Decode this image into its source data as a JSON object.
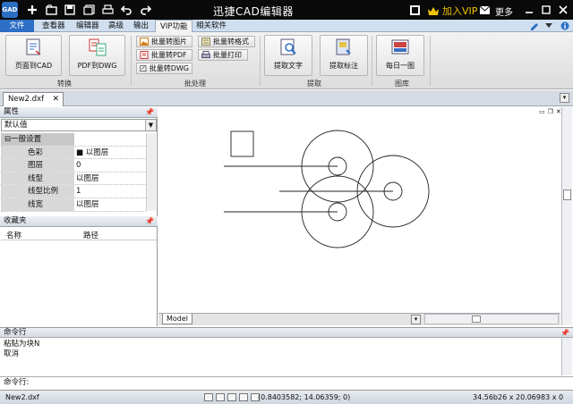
{
  "titlebar": {
    "app_logo": "GAD",
    "title": "迅捷CAD编辑器",
    "vip_label": "加入VIP",
    "more_label": "更多",
    "quick_access_icons": [
      "new-file-icon",
      "open-icon",
      "save-icon",
      "save-all-icon",
      "print-icon",
      "undo-icon",
      "redo-icon"
    ]
  },
  "menu": {
    "tabs": [
      "文件",
      "查看器",
      "编辑器",
      "高级",
      "输出",
      "VIP功能",
      "相关软件"
    ],
    "active_tab": "VIP功能"
  },
  "ribbon": {
    "groups": [
      {
        "label": "转换",
        "buttons": [
          "页面到CAD",
          "PDF到DWG"
        ]
      },
      {
        "label": "批处理",
        "buttons": [
          "批量转图片",
          "批量转PDF",
          "批量转DWG",
          "批量转格式",
          "批量打印"
        ]
      },
      {
        "label": "提取",
        "buttons": [
          "提取文字",
          "提取标注"
        ]
      },
      {
        "label": "图库",
        "buttons": [
          "每日一图"
        ]
      }
    ]
  },
  "document": {
    "tab_label": "New2.dxf"
  },
  "properties_panel": {
    "header": "属性",
    "combo_value": "默认值",
    "section": "一般设置",
    "rows": [
      {
        "key": "色彩",
        "value": "■ 以图层"
      },
      {
        "key": "图层",
        "value": "0"
      },
      {
        "key": "线型",
        "value": "以图层"
      },
      {
        "key": "线型比例",
        "value": "1"
      },
      {
        "key": "线宽",
        "value": "以图层"
      }
    ]
  },
  "favorites_panel": {
    "header": "收藏夹",
    "columns": [
      "名称",
      "路径"
    ]
  },
  "drawing": {
    "model_tab": "Model"
  },
  "command": {
    "header": "命令行",
    "history": [
      "粘贴为块N",
      "取消"
    ],
    "input_label": "命令行:"
  },
  "statusbar": {
    "file": "New2.dxf",
    "coords": "(0.8403582; 14.06359; 0)",
    "size": "34.56b26 x 20.06983 x 0"
  },
  "colors": {
    "titlebar": "#0a0a0a",
    "file_tab": "#2d6fc6",
    "vip_gold": "#f0c200"
  }
}
